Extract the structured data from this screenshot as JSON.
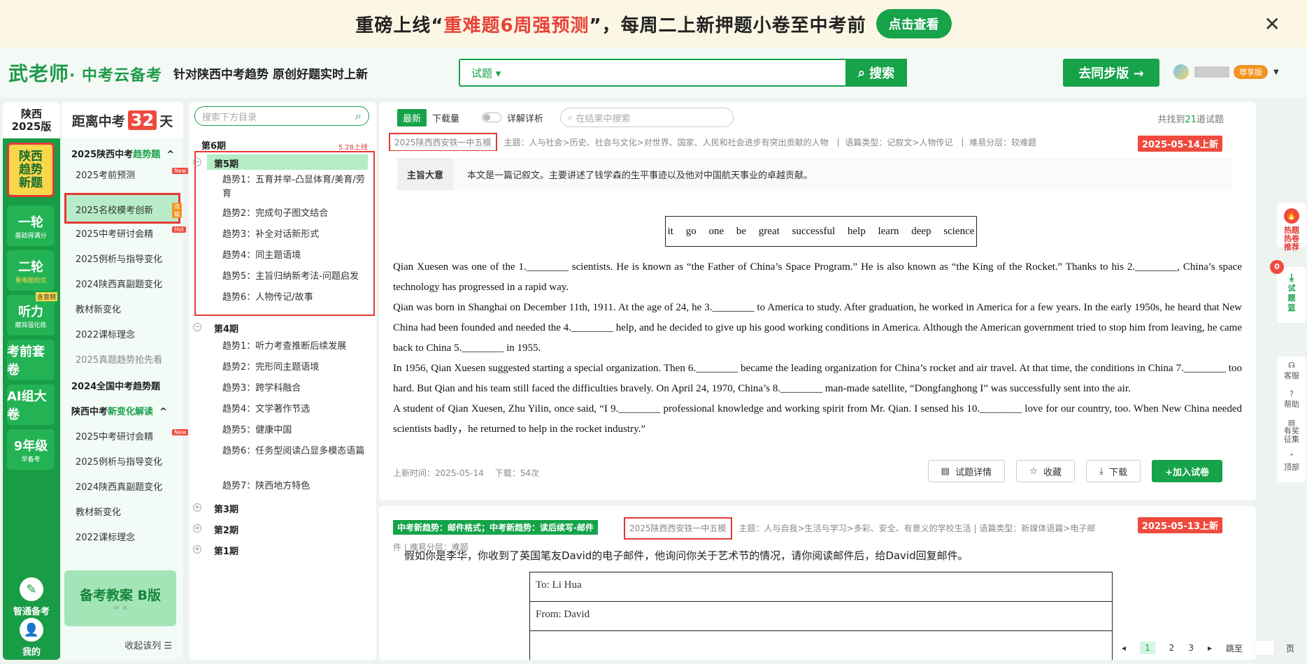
{
  "banner": {
    "text_pre": "重磅上线“",
    "text_hl": "重难题6周强预测",
    "text_post": "”，每周二上新押题小卷至中考前",
    "button": "点击查看",
    "close": "✕"
  },
  "header": {
    "logo_main": "武老师",
    "logo_sub": "· 中考云备考",
    "slogan": "针对陕西中考趋势 原创好题实时上新",
    "search_type": "试题 ▾",
    "search_placeholder": "",
    "search_button": "搜索",
    "sync_button": "去同步版 →",
    "vip_label": "尊享版"
  },
  "rail": {
    "region_line1": "陕西",
    "region_line2": "2025版",
    "items": [
      {
        "label": "陕西\n趋势\n新题",
        "sub": ""
      },
      {
        "label": "一轮",
        "sub": "基础得满分"
      },
      {
        "label": "二轮",
        "sub": "重难题拾优"
      },
      {
        "label": "听力",
        "sub": "磨耳强化练",
        "badge": "含音频"
      },
      {
        "label": "考前套卷",
        "sub": ""
      },
      {
        "label": "AI组大卷",
        "sub": ""
      },
      {
        "label": "9年级",
        "sub": "早备考"
      }
    ],
    "smart": "智通备考",
    "mine": "我的"
  },
  "menu": {
    "countdown_pre": "距离中考",
    "countdown_num": "32",
    "countdown_post": "天",
    "group1_pre": "2025陕西中考",
    "group1_hl": "趋势题",
    "items1": [
      {
        "label": "2025考前预测",
        "tag": "New"
      },
      {
        "label": "2025名校模考创新",
        "tag": "连载"
      },
      {
        "label": "2025中考研讨会精",
        "tag": "Hot"
      },
      {
        "label": "2025例析与指导变化",
        "tag": ""
      },
      {
        "label": "2024陕西真副题变化",
        "tag": ""
      },
      {
        "label": "教材新变化",
        "tag": ""
      },
      {
        "label": "2022课标理念",
        "tag": ""
      },
      {
        "label": "2025真题趋势抢先看",
        "tag": ""
      }
    ],
    "group2": "2024全国中考趋势题",
    "group3_pre": "陕西中考",
    "group3_hl": "新变化解读",
    "items3": [
      {
        "label": "2025中考研讨会精",
        "tag": "New"
      },
      {
        "label": "2025例析与指导变化",
        "tag": ""
      },
      {
        "label": "2024陕西真副题变化",
        "tag": ""
      },
      {
        "label": "教材新变化",
        "tag": ""
      },
      {
        "label": "2022课标理念",
        "tag": ""
      }
    ],
    "plan_card": "备考教案 B版",
    "collapse": "收起该列 ☰"
  },
  "tree": {
    "search_placeholder": "搜索下方目录",
    "p6": "第6期",
    "p6_note": "5.28上线",
    "p5": "第5期",
    "p5_topics": [
      "趋势1：五育并举-凸显体育/美育/劳育",
      "趋势2：完成句子图文结合",
      "趋势3：补全对话新形式",
      "趋势4：同主题语境",
      "趋势5：主旨归纳新考法-问题启发",
      "趋势6：人物传记/故事"
    ],
    "p4": "第4期",
    "p4_topics": [
      "趋势1：听力考查推断后续发展",
      "趋势2：完形同主题语境",
      "趋势3：跨学科融合",
      "趋势4：文学著作节选",
      "趋势5：健康中国",
      "趋势6：任务型阅读凸显多模态语篇",
      "趋势7：陕西地方特色"
    ],
    "p3": "第3期",
    "p2": "第2期",
    "p1": "第1期"
  },
  "toolbar": {
    "tab_latest": "最新",
    "tab_downloads": "下载量",
    "detail_toggle": "详解详析",
    "result_search_placeholder": "在结果中搜索",
    "found_pre": "共找到",
    "found_num": "21",
    "found_post": "道试题"
  },
  "q1": {
    "source": "2025陕西西安铁一中五模",
    "meta_topic": "主题：人与社会>历史、社会与文化>对世界、国家、人民和社会进步有突出贡献的人物",
    "meta_genre": "语篇类型：记叙文>人物传记",
    "meta_level": "难易分层：较难题",
    "date": "2025-05-14上新",
    "gist_label": "主旨大意",
    "gist_text": "本文是一篇记叙文。主要讲述了钱学森的生平事迹以及他对中国航天事业的卓越贡献。",
    "word_bank": "it go one be great successful help learn deep science",
    "paragraphs": [
      "Qian Xuesen was one of the 1.________ scientists. He is known as “the Father of China’s Space Program.” He is also known as “the King of the Rocket.” Thanks to his 2.________, China’s space technology has progressed in a rapid way.",
      "Qian was born in Shanghai on December 11th, 1911. At the age of 24, he 3.________ to America to study. After graduation, he worked in America for a few years. In the early 1950s, he heard that New China had been founded and needed the 4.________ help, and he decided to give up his good working conditions in America. Although the American government tried to stop him from leaving, he came back to China 5.________ in 1955.",
      "In 1956, Qian Xuesen suggested starting a special organization. Then 6.________ became the leading organization for China’s rocket and air travel. At that time, the conditions in China 7.________ too hard. But Qian and his team still faced the difficulties bravely. On April 24, 1970, China’s 8.________ man-made satellite, “Dongfanghong I” was successfully sent into the air.",
      "A student of Qian Xuesen, Zhu Yilin, once said, “I 9.________ professional knowledge and working spirit from Mr. Qian. I sensed his 10.________ love for our country, too. When New China needed scientists badly，he returned to help in the rocket industry.”"
    ],
    "upload_time": "上新时间：2025-05-14",
    "downloads": "下载：54次",
    "btn_detail": "试题详情",
    "btn_fav": "收藏",
    "btn_download": "下载",
    "btn_add": "+加入试卷"
  },
  "q2": {
    "tag": "中考新趋势：邮件格式；中考新趋势：读后续写-邮件",
    "source": "2025陕西西安铁一中五模",
    "meta_topic": "主题：人与自我>生活与学习>多彩、安全、有意义的学校生活",
    "meta_genre": "语篇类型：新媒体语篇>电子邮件",
    "meta_level": "难易分层：难题",
    "date": "2025-05-13上新",
    "prompt": "假如你是李华，你收到了英国笔友David的电子邮件，他询问你关于艺术节的情况，请你阅读邮件后，给David回复邮件。",
    "to": "To: Li Hua",
    "from": "From: David"
  },
  "rbar": {
    "hot": "热题热卷推荐",
    "basket_count": "0",
    "basket": "试题篮",
    "service": "客服",
    "help": "帮助",
    "reward": "有奖征集",
    "top": "顶部"
  },
  "pager": {
    "pages": [
      "1",
      "2",
      "3"
    ],
    "jump_pre": "跳至",
    "jump_post": "页"
  }
}
